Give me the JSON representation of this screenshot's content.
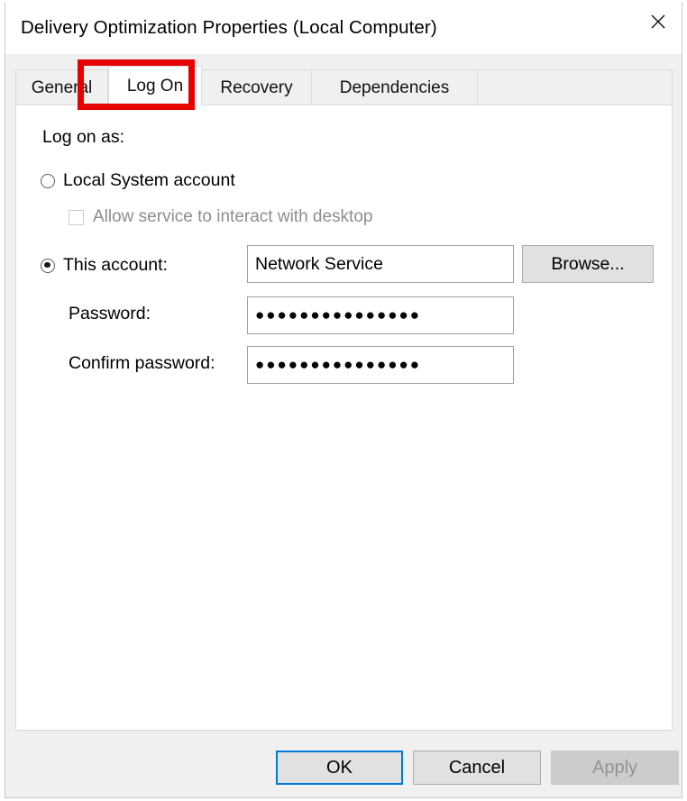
{
  "window": {
    "title": "Delivery Optimization Properties (Local Computer)",
    "close_icon": "close-icon"
  },
  "tabs": [
    {
      "label": "General",
      "active": false
    },
    {
      "label": "Log On",
      "active": true
    },
    {
      "label": "Recovery",
      "active": false
    },
    {
      "label": "Dependencies",
      "active": false
    }
  ],
  "form": {
    "legend": "Log on as:",
    "local_system": {
      "label": "Local System account",
      "selected": false
    },
    "allow_desktop": {
      "label": "Allow service to interact with desktop",
      "checked": false,
      "enabled": false
    },
    "this_account": {
      "label": "This account:",
      "selected": true,
      "value": "Network Service",
      "browse_label": "Browse..."
    },
    "password": {
      "label": "Password:",
      "value": "●●●●●●●●●●●●●●●"
    },
    "confirm_password": {
      "label": "Confirm password:",
      "value": "●●●●●●●●●●●●●●●"
    }
  },
  "footer": {
    "ok_label": "OK",
    "cancel_label": "Cancel",
    "apply_label": "Apply",
    "apply_enabled": false
  },
  "annotation": {
    "type": "highlight-rectangle",
    "target": "Log On",
    "color": "#e60000"
  }
}
